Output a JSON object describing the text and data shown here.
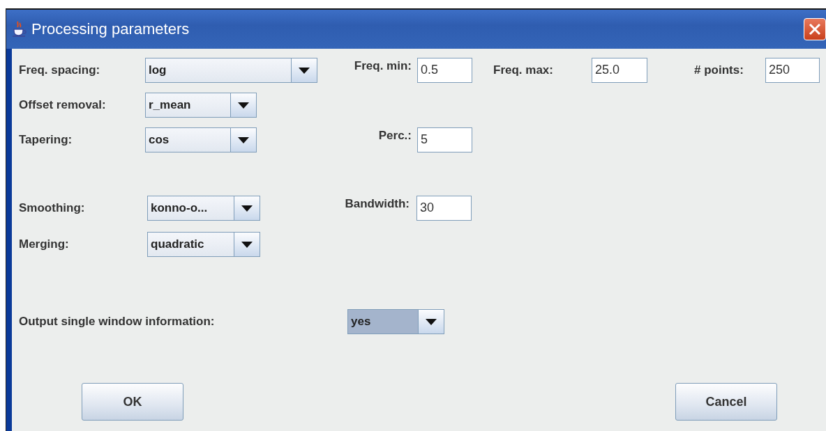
{
  "window": {
    "title": "Processing parameters"
  },
  "rows": [
    {
      "items": [
        {
          "kind": "label",
          "text": "Freq. spacing:"
        },
        {
          "kind": "combo",
          "value": "log",
          "focused": false
        },
        {
          "kind": "label",
          "text": "Freq. min:"
        },
        {
          "kind": "field",
          "value": "0.5"
        },
        {
          "kind": "label",
          "text": "Freq. max:"
        },
        {
          "kind": "field",
          "value": "25.0"
        },
        {
          "kind": "label",
          "text": "# points:"
        },
        {
          "kind": "field",
          "value": "250"
        }
      ]
    },
    {
      "items": [
        {
          "kind": "label",
          "text": "Offset removal:"
        },
        {
          "kind": "combo",
          "value": "r_mean",
          "focused": false
        }
      ]
    },
    {
      "items": [
        {
          "kind": "label",
          "text": "Tapering:"
        },
        {
          "kind": "combo",
          "value": "cos",
          "focused": false
        },
        {
          "kind": "label",
          "text": "Perc.:"
        },
        {
          "kind": "field",
          "value": "5"
        }
      ]
    },
    {
      "items": [
        {
          "kind": "label",
          "text": "Smoothing:"
        },
        {
          "kind": "combo",
          "value": "konno-o...",
          "focused": false
        },
        {
          "kind": "label",
          "text": "Bandwidth:"
        },
        {
          "kind": "field",
          "value": "30"
        }
      ]
    },
    {
      "items": [
        {
          "kind": "label",
          "text": "Merging:"
        },
        {
          "kind": "combo",
          "value": "quadratic",
          "focused": false
        }
      ]
    },
    {
      "items": [
        {
          "kind": "label",
          "text": "Output single window information:"
        },
        {
          "kind": "combo",
          "value": "yes",
          "focused": true
        }
      ]
    }
  ],
  "buttons": [
    "OK",
    "Cancel"
  ]
}
